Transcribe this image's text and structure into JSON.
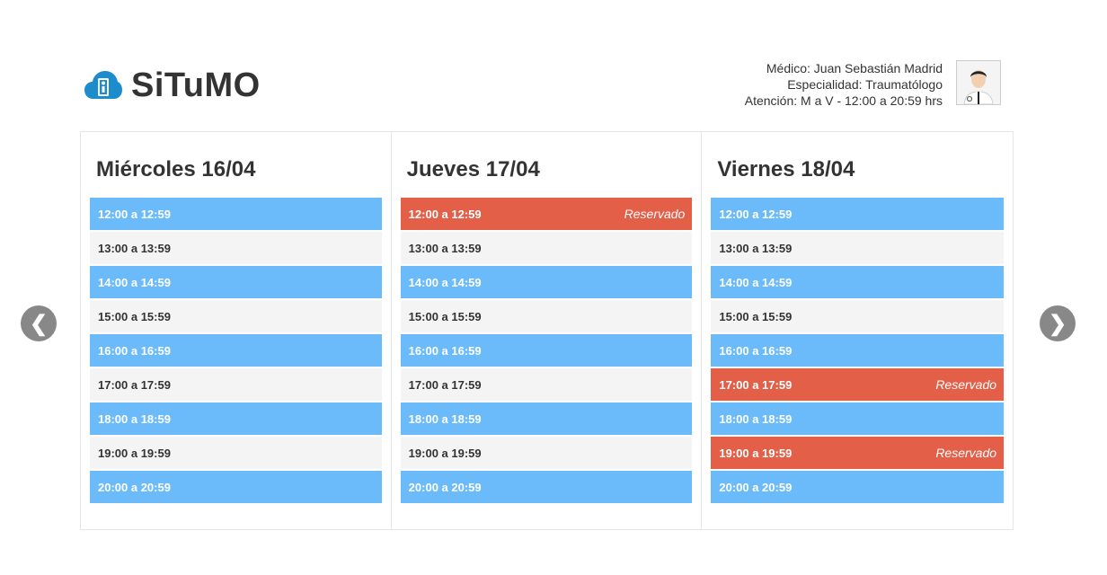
{
  "brand": {
    "name": "SiTuMO"
  },
  "doctor": {
    "line1": "Médico: Juan Sebastián Madrid",
    "line2": "Especialidad: Traumatólogo",
    "line3": "Atención: M a V - 12:00 a 20:59 hrs"
  },
  "nav": {
    "prev": "❮",
    "next": "❯"
  },
  "colors": {
    "free": "#6bbbfb",
    "alt": "#f4f4f4",
    "reserved": "#e35f48"
  },
  "days": [
    {
      "title": "Miércoles 16/04",
      "slots": [
        {
          "time": "12:00 a 12:59",
          "state": "free",
          "status": ""
        },
        {
          "time": "13:00 a 13:59",
          "state": "alt",
          "status": ""
        },
        {
          "time": "14:00 a 14:59",
          "state": "free",
          "status": ""
        },
        {
          "time": "15:00 a 15:59",
          "state": "alt",
          "status": ""
        },
        {
          "time": "16:00 a 16:59",
          "state": "free",
          "status": ""
        },
        {
          "time": "17:00 a 17:59",
          "state": "alt",
          "status": ""
        },
        {
          "time": "18:00 a 18:59",
          "state": "free",
          "status": ""
        },
        {
          "time": "19:00 a 19:59",
          "state": "alt",
          "status": ""
        },
        {
          "time": "20:00 a 20:59",
          "state": "free",
          "status": ""
        }
      ]
    },
    {
      "title": "Jueves 17/04",
      "slots": [
        {
          "time": "12:00 a 12:59",
          "state": "reserved",
          "status": "Reservado"
        },
        {
          "time": "13:00 a 13:59",
          "state": "alt",
          "status": ""
        },
        {
          "time": "14:00 a 14:59",
          "state": "free",
          "status": ""
        },
        {
          "time": "15:00 a 15:59",
          "state": "alt",
          "status": ""
        },
        {
          "time": "16:00 a 16:59",
          "state": "free",
          "status": ""
        },
        {
          "time": "17:00 a 17:59",
          "state": "alt",
          "status": ""
        },
        {
          "time": "18:00 a 18:59",
          "state": "free",
          "status": ""
        },
        {
          "time": "19:00 a 19:59",
          "state": "alt",
          "status": ""
        },
        {
          "time": "20:00 a 20:59",
          "state": "free",
          "status": ""
        }
      ]
    },
    {
      "title": "Viernes 18/04",
      "slots": [
        {
          "time": "12:00 a 12:59",
          "state": "free",
          "status": ""
        },
        {
          "time": "13:00 a 13:59",
          "state": "alt",
          "status": ""
        },
        {
          "time": "14:00 a 14:59",
          "state": "free",
          "status": ""
        },
        {
          "time": "15:00 a 15:59",
          "state": "alt",
          "status": ""
        },
        {
          "time": "16:00 a 16:59",
          "state": "free",
          "status": ""
        },
        {
          "time": "17:00 a 17:59",
          "state": "reserved",
          "status": "Reservado"
        },
        {
          "time": "18:00 a 18:59",
          "state": "free",
          "status": ""
        },
        {
          "time": "19:00 a 19:59",
          "state": "reserved",
          "status": "Reservado"
        },
        {
          "time": "20:00 a 20:59",
          "state": "free",
          "status": ""
        }
      ]
    }
  ]
}
